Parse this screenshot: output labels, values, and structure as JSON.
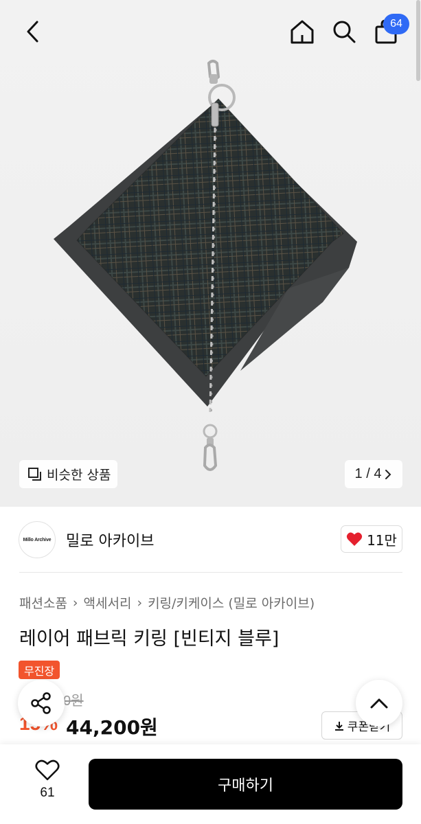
{
  "header": {
    "back_icon": "chevron-left-icon",
    "home_icon": "home-icon",
    "search_icon": "search-icon",
    "bag_icon": "shopping-bag-icon",
    "cart_count": "64"
  },
  "gallery": {
    "similar_label": "비슷한 상품",
    "similar_icon": "copy-icon",
    "pager": "1 / 4",
    "pager_icon": "chevron-right-icon"
  },
  "store": {
    "logo_text": "Millo Archive",
    "name": "밀로 아카이브",
    "like_count": "11만",
    "heart_color": "#e5202e"
  },
  "product": {
    "breadcrumb": [
      "패션소품",
      "액세서리",
      "키링/키케이스 (밀로 아카이브)"
    ],
    "title": "레이어 패브릭 키링 [빈티지 블루]",
    "tag": "무진장",
    "original_price": "52,000원",
    "discount": "15%",
    "price": "44,200원",
    "coupon_label": "쿠폰받기"
  },
  "bottom": {
    "wish_count": "61",
    "buy_label": "구매하기"
  },
  "colors": {
    "accent": "#f2542d",
    "badge": "#2f6af5",
    "buy_button": "#000000"
  }
}
